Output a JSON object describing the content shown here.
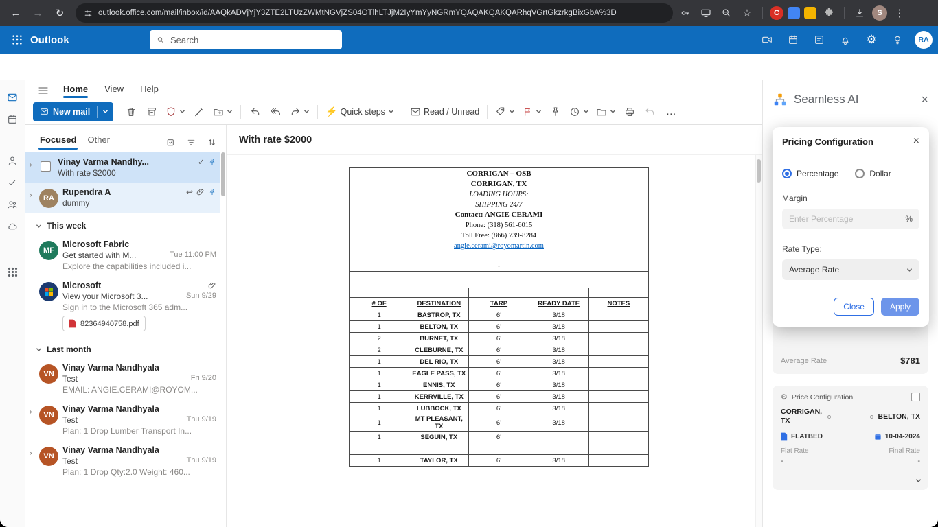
{
  "browser": {
    "url": "outlook.office.com/mail/inbox/id/AAQkADVjYjY3ZTE2LTUzZWMtNGVjZS04OTlhLTJjM2IyYmYyNGRmYQAQAKQAKQARhqVGrtGkzrkgBixGbA%3D",
    "profile_initial": "S"
  },
  "outlook": {
    "app_name": "Outlook",
    "search_placeholder": "Search",
    "avatar": "RA"
  },
  "ribbon": {
    "tabs": [
      "Home",
      "View",
      "Help"
    ],
    "active_tab": "Home",
    "new_mail": "New mail",
    "quick_steps": "Quick steps",
    "read_unread": "Read / Unread",
    "more": "…"
  },
  "list": {
    "tab_focused": "Focused",
    "tab_other": "Other",
    "pinned": [
      {
        "sender": "Vinay Varma Nandhy...",
        "subject": "With rate $2000"
      },
      {
        "sender": "Rupendra A",
        "subject": "dummy",
        "avatar": "RA",
        "avatar_color": "#9e8260"
      }
    ],
    "sections": [
      {
        "heading": "This week",
        "messages": [
          {
            "avatar": "MF",
            "avatar_color": "#1f7a5c",
            "sender": "Microsoft Fabric",
            "subject": "Get started with M...",
            "time": "Tue 11:00 PM",
            "preview": "Explore the capabilities included i..."
          },
          {
            "avatar": "",
            "avatar_color": "#1b3a70",
            "sender": "Microsoft",
            "subject": "View your Microsoft 3...",
            "time": "Sun 9/29",
            "preview": "Sign in to the Microsoft 365 adm...",
            "attachment": "82364940758.pdf"
          }
        ]
      },
      {
        "heading": "Last month",
        "messages": [
          {
            "avatar": "VN",
            "avatar_color": "#b65425",
            "sender": "Vinay Varma Nandhyala",
            "subject": "Test",
            "time": "Fri 9/20",
            "preview": "EMAIL: ANGIE.CERAMI@ROYOM..."
          },
          {
            "avatar": "VN",
            "avatar_color": "#b65425",
            "sender": "Vinay Varma Nandhyala",
            "subject": "Test",
            "time": "Thu 9/19",
            "preview": "Plan: 1 Drop Lumber Transport In..."
          },
          {
            "avatar": "VN",
            "avatar_color": "#b65425",
            "sender": "Vinay Varma Nandhyala",
            "subject": "Test",
            "time": "Thu 9/19",
            "preview": "Plan: 1 Drop Qty:2.0 Weight: 460..."
          }
        ]
      }
    ]
  },
  "reading": {
    "subject": "With rate $2000",
    "doc": {
      "title1": "CORRIGAN – OSB",
      "title2": "CORRIGAN, TX",
      "hours1": "LOADING HOURS:",
      "hours2": "SHIPPING 24/7",
      "contact": "Contact: ANGIE CERAMI",
      "phone": "Phone: (318) 561-6015",
      "tollfree": "Toll Free: (866) 739-8284",
      "email": "angie.cerami@royomartin.com",
      "dash": "-",
      "headers": [
        "# OF",
        "DESTINATION",
        "TARP",
        "READY DATE",
        "NOTES"
      ],
      "rows": [
        [
          "1",
          "BASTROP, TX",
          "6'",
          "3/18",
          ""
        ],
        [
          "1",
          "BELTON, TX",
          "6'",
          "3/18",
          ""
        ],
        [
          "2",
          "BURNET, TX",
          "6'",
          "3/18",
          ""
        ],
        [
          "2",
          "CLEBURNE, TX",
          "6'",
          "3/18",
          ""
        ],
        [
          "1",
          "DEL RIO, TX",
          "6'",
          "3/18",
          ""
        ],
        [
          "1",
          "EAGLE PASS, TX",
          "6'",
          "3/18",
          ""
        ],
        [
          "1",
          "ENNIS, TX",
          "6'",
          "3/18",
          ""
        ],
        [
          "1",
          "KERRVILLE, TX",
          "6'",
          "3/18",
          ""
        ],
        [
          "1",
          "LUBBOCK, TX",
          "6'",
          "3/18",
          ""
        ],
        [
          "1",
          "MT PLEASANT, TX",
          "6'",
          "3/18",
          ""
        ],
        [
          "1",
          "SEGUIN, TX",
          "6'",
          "",
          ""
        ],
        [
          "",
          "",
          "",
          "",
          ""
        ],
        [
          "1",
          "TAYLOR, TX",
          "6'",
          "3/18",
          ""
        ]
      ]
    }
  },
  "panel": {
    "title": "Seamless AI",
    "average_rate_label": "Average Rate",
    "average_rate_value": "$781",
    "price_config": {
      "title": "Price Configuration",
      "origin": "CORRIGAN, TX",
      "destination": "BELTON, TX",
      "equipment": "FLATBED",
      "date": "10-04-2024",
      "flat_rate_label": "Flat Rate",
      "final_rate_label": "Final Rate",
      "flat_rate_value": "-",
      "final_rate_value": "-"
    }
  },
  "modal": {
    "title": "Pricing Configuration",
    "radio_percentage": "Percentage",
    "radio_dollar": "Dollar",
    "margin_label": "Margin",
    "margin_placeholder": "Enter Percentage",
    "percent_suffix": "%",
    "rate_type_label": "Rate Type:",
    "rate_type_value": "Average Rate",
    "close_button": "Close",
    "apply_button": "Apply"
  },
  "colors": {
    "outlook_blue": "#0f6cbd",
    "selected_message_bg": "#cfe3f8",
    "apply_blue": "#6d95ea",
    "link_blue": "#0563c1",
    "pdf_red": "#d13438"
  }
}
